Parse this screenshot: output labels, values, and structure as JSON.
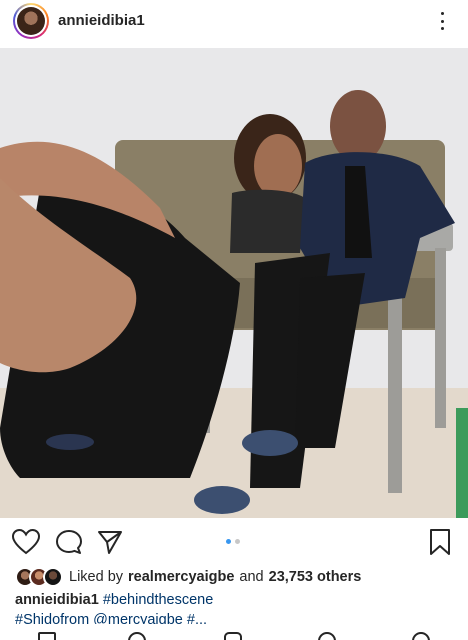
{
  "post": {
    "username": "annieidibia1",
    "photo_description_icon": "photo",
    "likes": {
      "prefix": "Liked by",
      "liker": "realmercyaigbe",
      "connector": "and",
      "others": "23,753 others"
    },
    "caption": {
      "username": "annieidibia1",
      "hashtag": "#behindthescene",
      "truncated_line": "#Shidofrom @mercyaigbe #..."
    }
  },
  "icons": {
    "more": "more-vertical-icon",
    "like": "heart-icon",
    "comment": "comment-icon",
    "share": "paper-plane-icon",
    "save": "bookmark-icon"
  },
  "carousel": {
    "current": 1,
    "total": 2
  },
  "colors": {
    "accent": "#3897f0",
    "hashtag": "#003569",
    "text": "#262626"
  }
}
